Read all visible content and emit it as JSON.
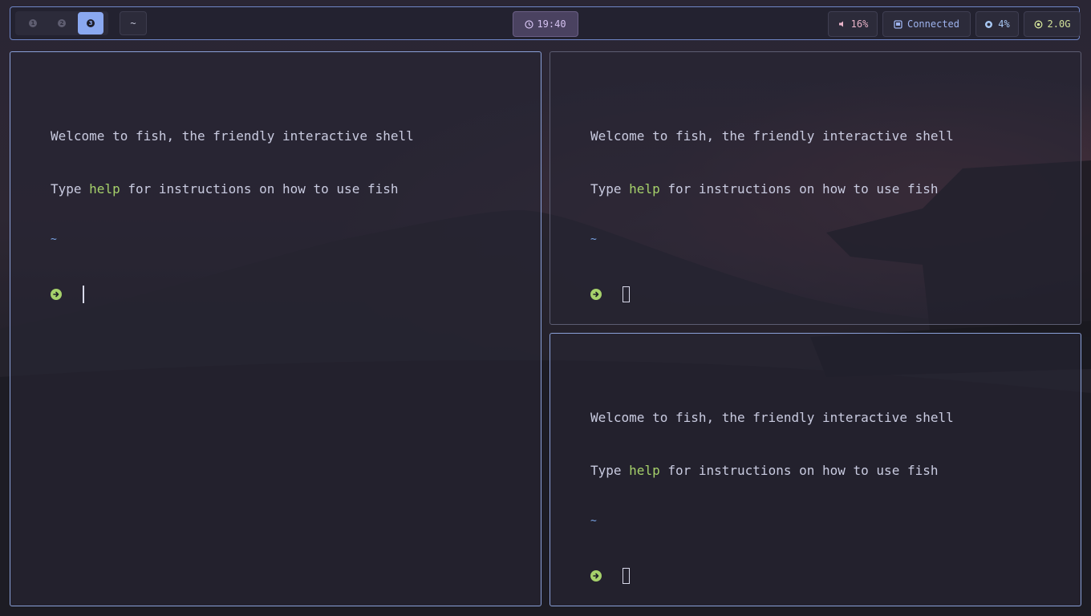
{
  "topbar": {
    "workspaces": [
      {
        "label": "1",
        "active": false
      },
      {
        "label": "2",
        "active": false
      },
      {
        "label": "3",
        "active": true
      }
    ],
    "path": "~",
    "clock": "19:40",
    "volume": "16%",
    "network": "Connected",
    "cpu": "4%",
    "memory": "2.0G"
  },
  "terminals": [
    {
      "welcome": "Welcome to fish, the friendly interactive shell",
      "type_word": "Type ",
      "help_word": "help",
      "instructions_rest": " for instructions on how to use fish",
      "cwd": "~"
    },
    {
      "welcome": "Welcome to fish, the friendly interactive shell",
      "type_word": "Type ",
      "help_word": "help",
      "instructions_rest": " for instructions on how to use fish",
      "cwd": "~"
    },
    {
      "welcome": "Welcome to fish, the friendly interactive shell",
      "type_word": "Type ",
      "help_word": "help",
      "instructions_rest": " for instructions on how to use fish",
      "cwd": "~"
    }
  ],
  "colors": {
    "accent": "#8aa8f0",
    "prompt_green": "#a6d16b",
    "cwd_blue": "#7aa6e8"
  }
}
